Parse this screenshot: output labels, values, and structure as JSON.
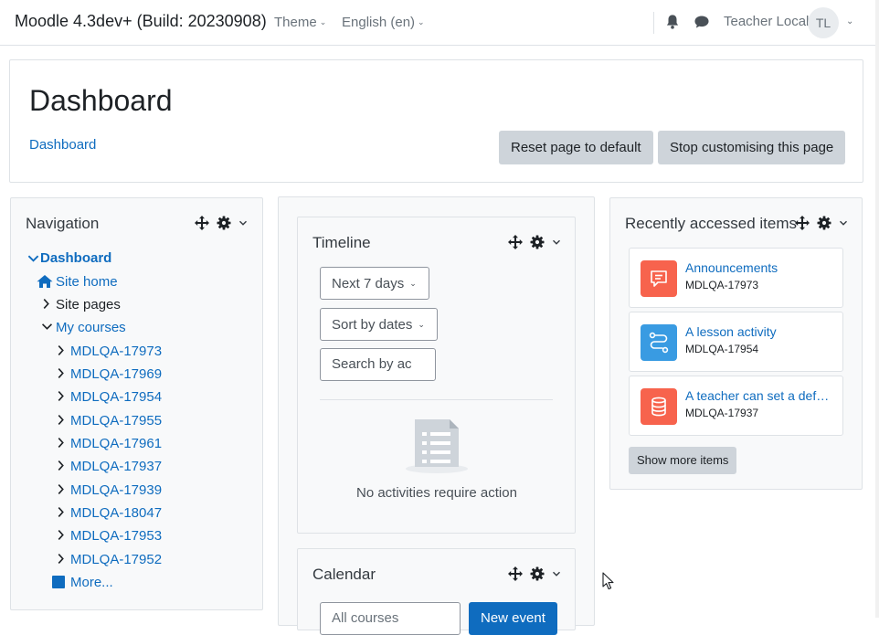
{
  "header": {
    "site_name": "Moodle 4.3dev+ (Build: 20230908)",
    "theme_label": "Theme",
    "language_label": "English (en)",
    "user_name": "Teacher Local",
    "avatar_initials": "TL"
  },
  "page": {
    "title": "Dashboard",
    "breadcrumb": "Dashboard",
    "reset_button": "Reset page to default",
    "stop_button": "Stop customising this page"
  },
  "navigation": {
    "title": "Navigation",
    "dashboard": "Dashboard",
    "site_home": "Site home",
    "site_pages": "Site pages",
    "my_courses": "My courses",
    "courses": [
      "MDLQA-17973",
      "MDLQA-17969",
      "MDLQA-17954",
      "MDLQA-17955",
      "MDLQA-17961",
      "MDLQA-17937",
      "MDLQA-17939",
      "MDLQA-18047",
      "MDLQA-17953",
      "MDLQA-17952"
    ],
    "more": "More..."
  },
  "timeline": {
    "title": "Timeline",
    "filter": "Next 7 days",
    "sort": "Sort by dates",
    "search_placeholder": "Search by ac",
    "empty": "No activities require action"
  },
  "calendar": {
    "title": "Calendar",
    "course_select": "All courses",
    "new_event": "New event"
  },
  "recent": {
    "title": "Recently accessed items",
    "items": [
      {
        "name": "Announcements",
        "course": "MDLQA-17973",
        "icon": "forum-icon",
        "color": "#f7634d"
      },
      {
        "name": "A lesson activity",
        "course": "MDLQA-17954",
        "icon": "lesson-icon",
        "color": "#399be2"
      },
      {
        "name": "A teacher can set a default...",
        "course": "MDLQA-17937",
        "icon": "database-icon",
        "color": "#f7634d"
      }
    ],
    "show_more": "Show more items"
  },
  "colors": {
    "link": "#0f6cbf",
    "primary": "#0f6cbf",
    "secondary_button": "#ced4da"
  }
}
